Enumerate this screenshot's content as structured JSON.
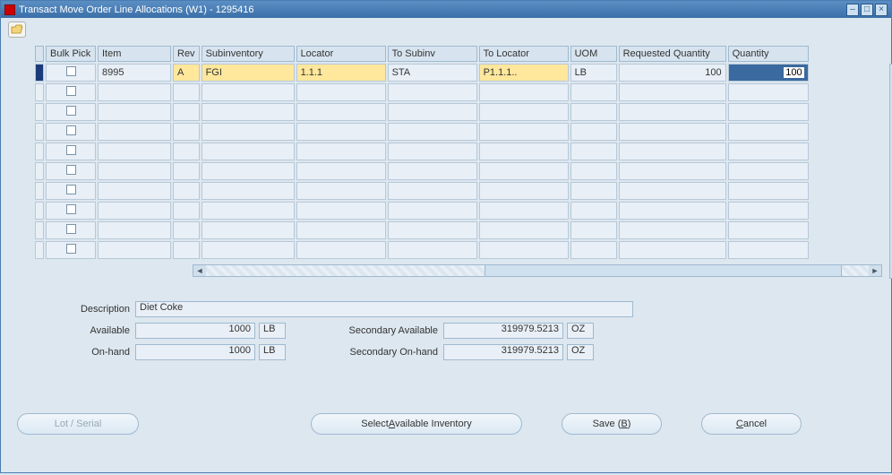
{
  "window": {
    "title": "Transact Move Order Line Allocations (W1) - 1295416"
  },
  "columns": {
    "bulkpick": "Bulk Pick",
    "item": "Item",
    "rev": "Rev",
    "subinv": "Subinventory",
    "locator": "Locator",
    "tosubinv": "To Subinv",
    "tolocator": "To Locator",
    "uom": "UOM",
    "reqqty": "Requested Quantity",
    "qty": "Quantity"
  },
  "rows": [
    {
      "item": "8995",
      "rev": "A",
      "subinv": "FGI",
      "locator": "1.1.1",
      "tosubinv": "STA",
      "tolocator": "P1.1.1..",
      "uom": "LB",
      "reqqty": "100",
      "qty": "100"
    }
  ],
  "form": {
    "labels": {
      "description": "Description",
      "available": "Available",
      "onhand": "On-hand",
      "sec_available": "Secondary Available",
      "sec_onhand": "Secondary On-hand"
    },
    "description": "Diet Coke",
    "available": "1000",
    "available_uom": "LB",
    "onhand": "1000",
    "onhand_uom": "LB",
    "sec_available": "319979.5213",
    "sec_available_uom": "OZ",
    "sec_onhand": "319979.5213",
    "sec_onhand_uom": "OZ"
  },
  "buttons": {
    "lot_serial": "Lot / Serial",
    "select_avail_pre": "Select ",
    "select_avail_hot": "A",
    "select_avail_post": "vailable Inventory",
    "save_pre": "Save (",
    "save_hot": "B",
    "save_post": ")",
    "cancel_pre": "",
    "cancel_hot": "C",
    "cancel_post": "ancel"
  }
}
